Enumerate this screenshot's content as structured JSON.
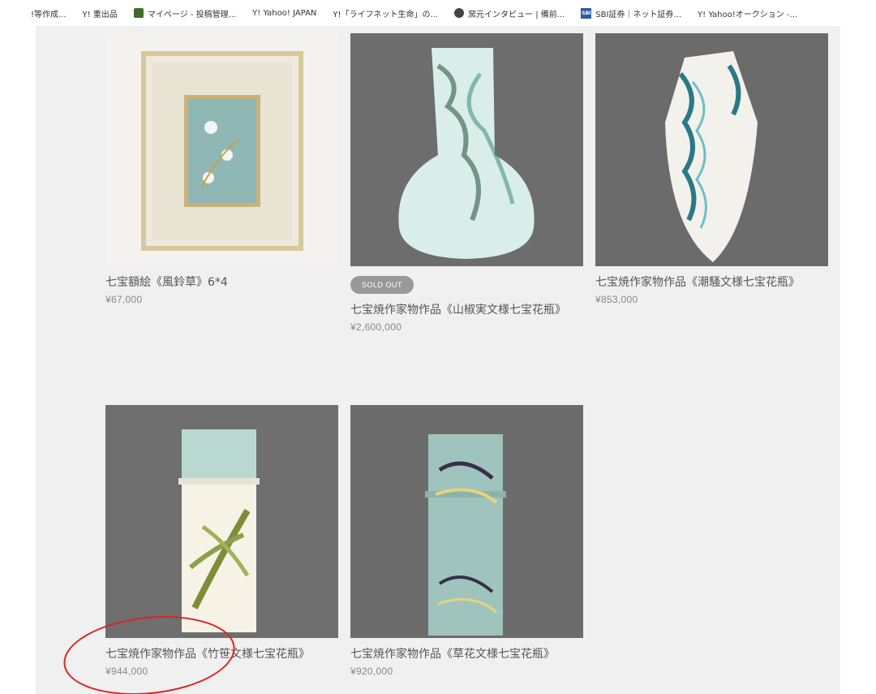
{
  "bookmarks": [
    {
      "icon": "doc-icon",
      "label": "!等作成..."
    },
    {
      "icon": "yahoo-icon",
      "label": "Y! 重出品"
    },
    {
      "icon": "leaf-icon",
      "label": "マイページ - 投稿管理..."
    },
    {
      "icon": "yahoo-icon",
      "label": "Y! Yahoo! JAPAN"
    },
    {
      "icon": "yahoo-icon",
      "label": "Y!「ライフネット生命」の..."
    },
    {
      "icon": "globe-icon",
      "label": "窯元インタビュー | 備前..."
    },
    {
      "icon": "sbi-icon",
      "label": "SBI証券｜ネット証券..."
    },
    {
      "icon": "yahoo-icon",
      "label": "Y! Yahoo!オークション -..."
    }
  ],
  "products": [
    {
      "title": "七宝額絵《風鈴草》6*4",
      "price": "¥67,000",
      "sold_out": false
    },
    {
      "title": "七宝焼作家物作品《山椒実文様七宝花瓶》",
      "price": "¥2,600,000",
      "sold_out": true,
      "badge": "SOLD OUT"
    },
    {
      "title": "七宝焼作家物作品《潮騒文様七宝花瓶》",
      "price": "¥853,000",
      "sold_out": false
    },
    {
      "title": "七宝焼作家物作品《竹笹文様七宝花瓶》",
      "price": "¥944,000",
      "sold_out": false
    },
    {
      "title": "七宝焼作家物作品《草花文様七宝花瓶》",
      "price": "¥920,000",
      "sold_out": false
    }
  ],
  "colors": {
    "annotation": "#d22222",
    "badge": "#999999",
    "panel": "#f0f0f0"
  }
}
